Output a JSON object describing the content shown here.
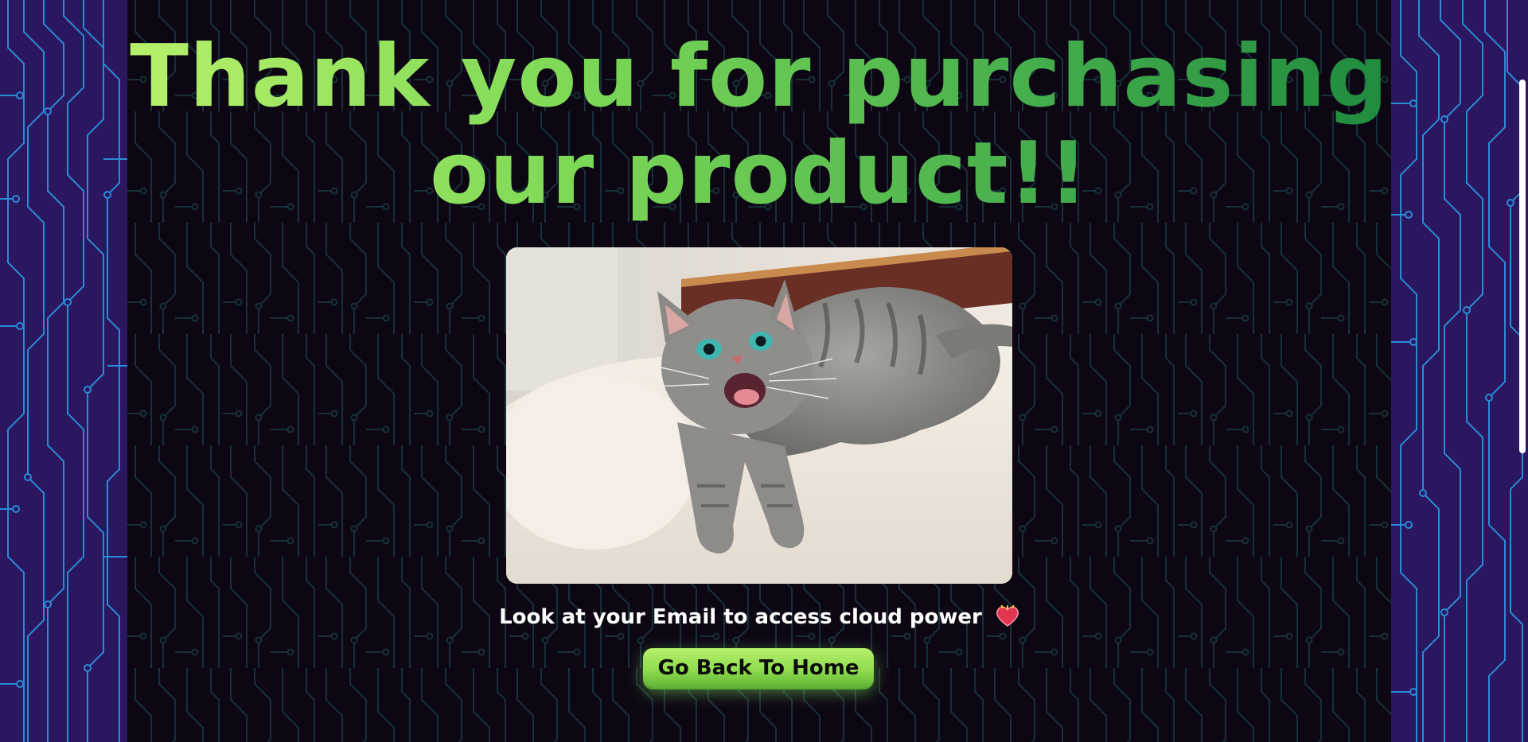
{
  "page": {
    "headline": "Thank you for purchasing our product!!",
    "email_note": "Look at your Email to access cloud power",
    "home_button_label": "Go Back To Home",
    "image_subject": "meowing gray tabby kitten on white bedsheet"
  },
  "icons": {
    "note_icon": "heart-icon"
  },
  "colors": {
    "side_background": "#2b1660",
    "side_circuit": "#2a8bd6",
    "main_background": "#0d0714",
    "main_circuit": "#17303a",
    "headline_gradient_start": "#b6f06a",
    "headline_gradient_end": "#1f8a3e",
    "button_green": "#8fdc4f",
    "note_text": "#ffffff"
  }
}
